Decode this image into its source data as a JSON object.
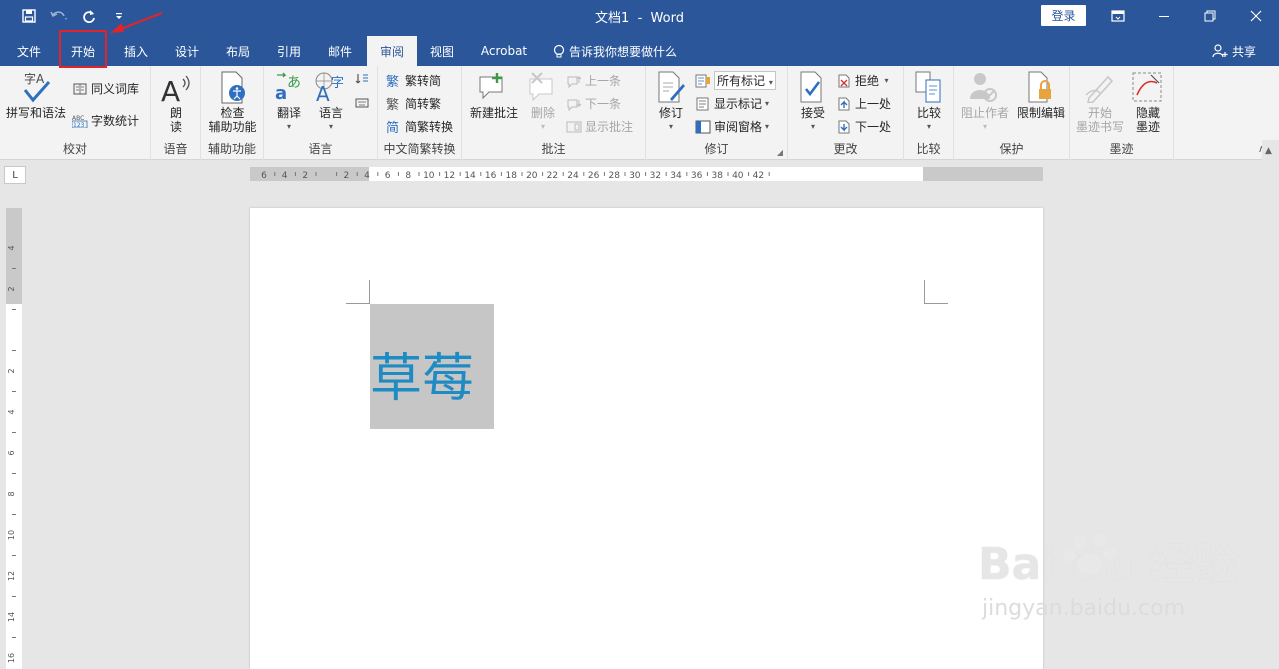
{
  "title_bar": {
    "document_name": "文档1",
    "separator": "-",
    "app_name": "Word",
    "login_label": "登录"
  },
  "tabs": [
    {
      "label": "文件",
      "active": false
    },
    {
      "label": "开始",
      "active": false
    },
    {
      "label": "插入",
      "active": false
    },
    {
      "label": "设计",
      "active": false
    },
    {
      "label": "布局",
      "active": false
    },
    {
      "label": "引用",
      "active": false
    },
    {
      "label": "邮件",
      "active": false
    },
    {
      "label": "审阅",
      "active": true
    },
    {
      "label": "视图",
      "active": false
    },
    {
      "label": "Acrobat",
      "active": false
    }
  ],
  "tell_me": "告诉我你想要做什么",
  "share_label": "共享",
  "ribbon": {
    "proofing": {
      "label": "校对",
      "spelling": "拼写和语法",
      "thesaurus": "同义词库",
      "word_count": "字数统计"
    },
    "speech": {
      "label": "语音",
      "read_aloud_1": "朗",
      "read_aloud_2": "读"
    },
    "accessibility": {
      "label": "辅助功能",
      "check_1": "检查",
      "check_2": "辅助功能"
    },
    "language": {
      "label": "语言",
      "translate": "翻译",
      "language": "语言"
    },
    "chinese_conversion": {
      "label": "中文简繁转换",
      "to_simplified": "繁转简",
      "to_traditional": "简转繁",
      "convert": "简繁转换"
    },
    "comments": {
      "label": "批注",
      "new_comment": "新建批注",
      "delete": "删除",
      "previous": "上一条",
      "next": "下一条",
      "show_comments": "显示批注"
    },
    "tracking": {
      "label": "修订",
      "track_changes": "修订",
      "markup_dropdown": "所有标记",
      "show_markup": "显示标记",
      "reviewing_pane": "审阅窗格"
    },
    "changes": {
      "label": "更改",
      "accept": "接受",
      "reject": "拒绝",
      "previous": "上一处",
      "next": "下一处"
    },
    "compare": {
      "label": "比较",
      "compare": "比较"
    },
    "protect": {
      "label": "保护",
      "block_authors": "阻止作者",
      "restrict_editing": "限制编辑"
    },
    "ink": {
      "label": "墨迹",
      "start_inking_1": "开始",
      "start_inking_2": "墨迹书写",
      "hide_ink_1": "隐藏",
      "hide_ink_2": "墨迹"
    }
  },
  "ruler": {
    "horizontal_ticks": [
      "6",
      "4",
      "2",
      "",
      "2",
      "4",
      "6",
      "8",
      "10",
      "12",
      "14",
      "16",
      "18",
      "20",
      "22",
      "24",
      "26",
      "28",
      "30",
      "32",
      "34",
      "36",
      "38",
      "40",
      "42"
    ],
    "vertical_ticks": [
      "4",
      "2",
      "",
      "2",
      "4",
      "6",
      "8",
      "10",
      "12",
      "14",
      "16"
    ],
    "corner": "L"
  },
  "document": {
    "text": "草莓"
  },
  "watermark": {
    "brand": "Bai  du 经验",
    "url": "jingyan.baidu.com"
  },
  "colors": {
    "title_bar": "#2b579a",
    "ribbon": "#f3f3f3",
    "text_color": "#1e8bc3",
    "highlight_box": "#e0242c"
  }
}
